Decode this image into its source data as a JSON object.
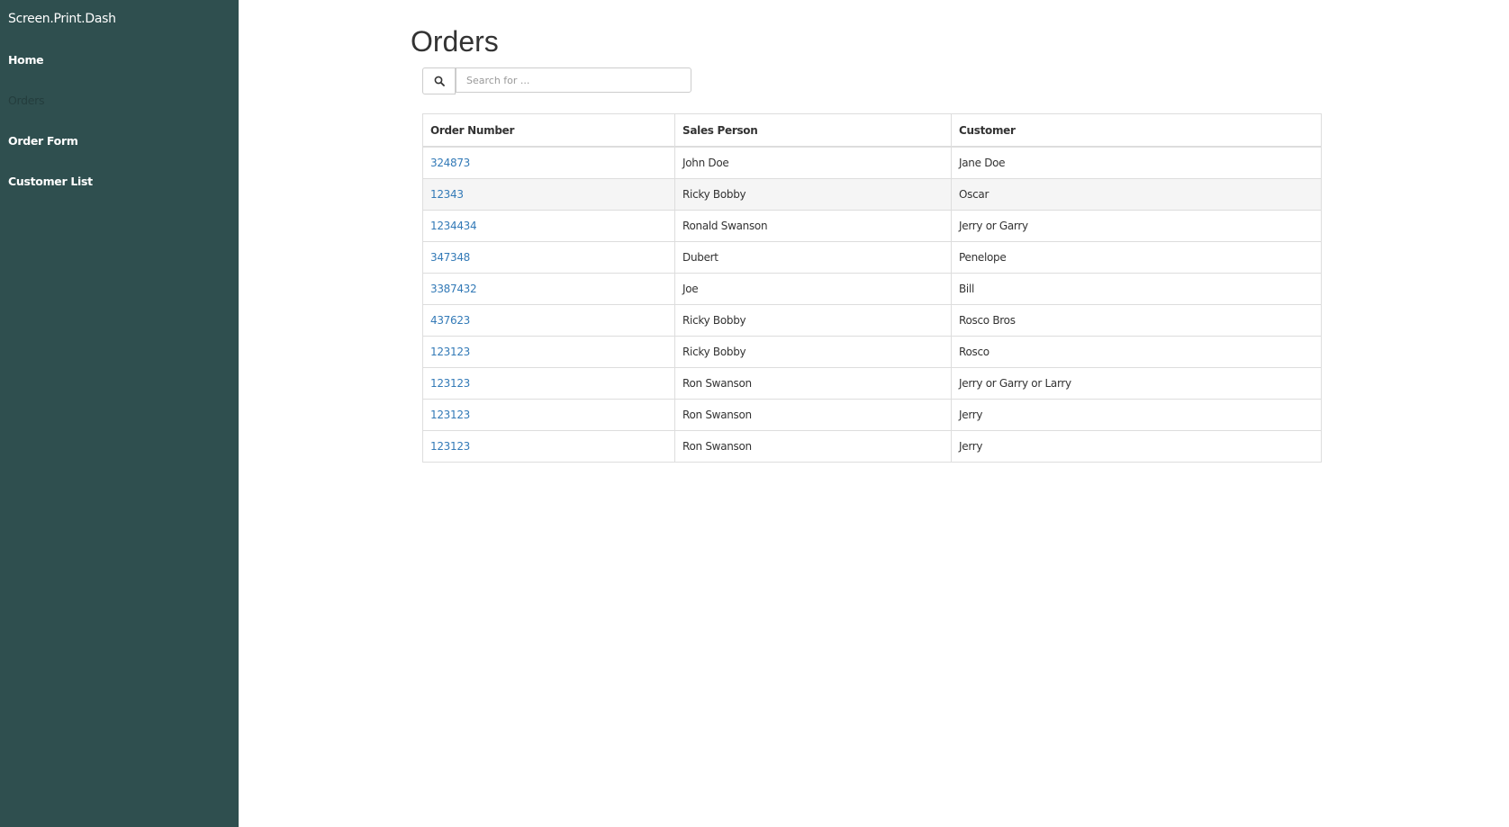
{
  "sidebar": {
    "brand": "Screen.Print.Dash",
    "items": [
      {
        "label": "Home"
      },
      {
        "label": "Orders"
      },
      {
        "label": "Order Form"
      },
      {
        "label": "Customer List"
      }
    ]
  },
  "main": {
    "title": "Orders",
    "search": {
      "icon": "search-icon",
      "placeholder": "Search for ..."
    },
    "table": {
      "headers": [
        "Order Number",
        "Sales Person",
        "Customer"
      ],
      "rows": [
        {
          "order": "324873",
          "sales": "John Doe",
          "customer": "Jane Doe"
        },
        {
          "order": "12343",
          "sales": "Ricky Bobby",
          "customer": "Oscar"
        },
        {
          "order": "1234434",
          "sales": "Ronald Swanson",
          "customer": "Jerry or Garry"
        },
        {
          "order": "347348",
          "sales": "Dubert",
          "customer": "Penelope"
        },
        {
          "order": "3387432",
          "sales": "Joe",
          "customer": "Bill"
        },
        {
          "order": "437623",
          "sales": "Ricky Bobby",
          "customer": "Rosco Bros"
        },
        {
          "order": "123123",
          "sales": "Ricky Bobby",
          "customer": "Rosco"
        },
        {
          "order": "123123",
          "sales": "Ron Swanson",
          "customer": "Jerry or Garry or Larry"
        },
        {
          "order": "123123",
          "sales": "Ron Swanson",
          "customer": "Jerry"
        },
        {
          "order": "123123",
          "sales": "Ron Swanson",
          "customer": "Jerry"
        }
      ]
    }
  },
  "colors": {
    "sidebar_bg": "#2f4f4f",
    "link": "#337ab7",
    "active_nav": "#243d3d",
    "row_stripe": "#f5f5f5"
  }
}
